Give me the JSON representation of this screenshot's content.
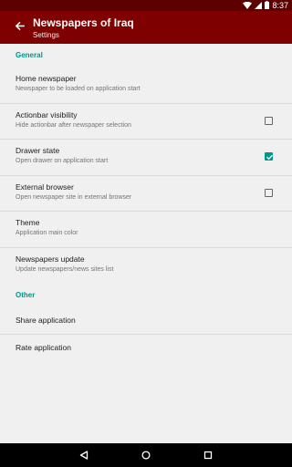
{
  "status_bar": {
    "time": "8:37",
    "icons": [
      "wifi-icon",
      "signal-icon",
      "battery-icon"
    ]
  },
  "app_bar": {
    "title": "Newspapers of Iraq",
    "subtitle": "Settings",
    "color": "#7f0000"
  },
  "sections": {
    "general": {
      "header": "General",
      "items": [
        {
          "title": "Home newspaper",
          "summary": "Newspaper to be loaded on application start"
        },
        {
          "title": "Actionbar visibility",
          "summary": "Hide actionbar after newspaper selection",
          "checked": false
        },
        {
          "title": "Drawer state",
          "summary": "Open drawer on application start",
          "checked": true
        },
        {
          "title": "External browser",
          "summary": "Open newspaper site in external browser",
          "checked": false
        },
        {
          "title": "Theme",
          "summary": "Application main color"
        },
        {
          "title": "Newspapers update",
          "summary": "Update newspapers/news sites list"
        }
      ]
    },
    "other": {
      "header": "Other",
      "items": [
        {
          "title": "Share application"
        },
        {
          "title": "Rate application"
        }
      ]
    }
  },
  "accent_color": "#009688",
  "nav_bar": {
    "icons": [
      "back-triangle-icon",
      "home-circle-icon",
      "recents-square-icon"
    ]
  }
}
